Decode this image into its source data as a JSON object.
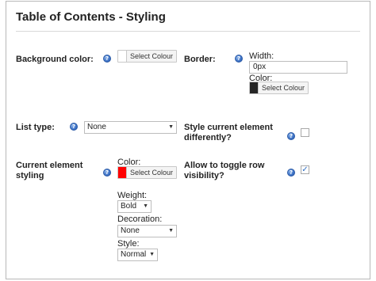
{
  "header": {
    "title": "Table of Contents - Styling"
  },
  "help_glyph": "?",
  "background": {
    "label": "Background color:",
    "swatch_color": "#ffffff",
    "button": "Select Colour"
  },
  "border": {
    "label": "Border:",
    "width_label": "Width:",
    "width_value": "0px",
    "color_label": "Color:",
    "swatch_color": "#262626",
    "button": "Select Colour"
  },
  "list_type": {
    "label": "List type:",
    "selected": "None"
  },
  "style_current": {
    "label_line1": "Style current element",
    "label_line2": "differently?",
    "checked": false
  },
  "current_styling": {
    "label_line1": "Current element",
    "label_line2": "styling",
    "color_label": "Color:",
    "swatch_color": "#ff0000",
    "button": "Select Colour",
    "weight_label": "Weight:",
    "weight_value": "Bold",
    "decoration_label": "Decoration:",
    "decoration_value": "None",
    "style_label": "Style:",
    "style_value": "Normal"
  },
  "toggle_visibility": {
    "label_line1": "Allow to toggle row",
    "label_line2": "visibility?",
    "checked": true,
    "check_glyph": "✓"
  },
  "select_arrow": "▼"
}
